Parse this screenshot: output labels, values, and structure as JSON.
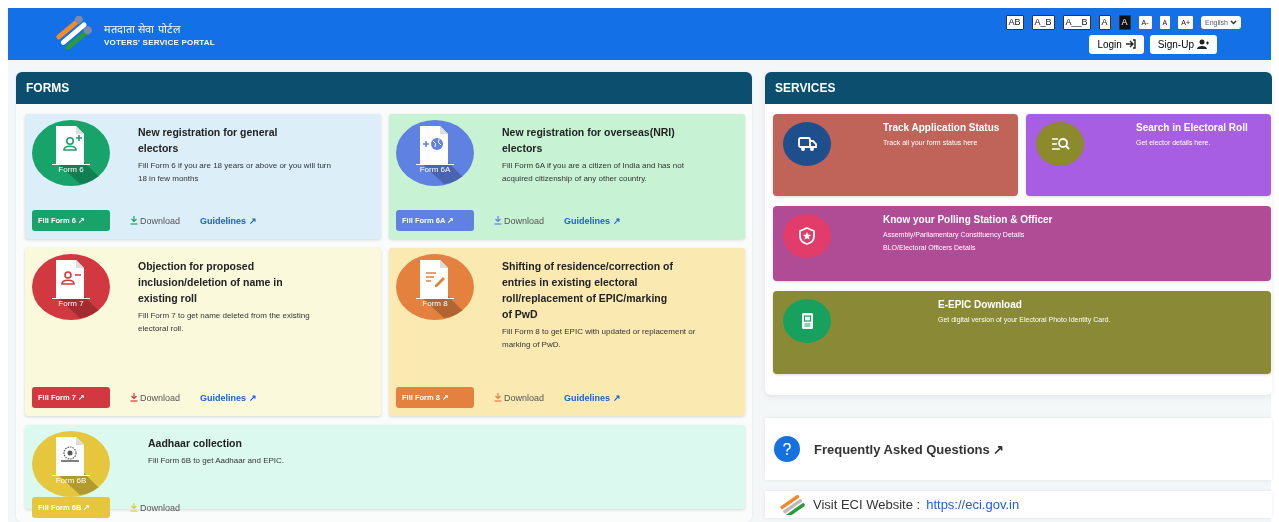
{
  "header": {
    "title_hindi": "मतदाता सेवा पोर्टल",
    "title": "VOTERS' SERVICE PORTAL",
    "spacing_buttons": [
      "AB",
      "A_B",
      "A__B"
    ],
    "contrast_buttons": [
      {
        "label": "A",
        "kind": "light"
      },
      {
        "label": "A",
        "kind": "dark"
      }
    ],
    "font_buttons": [
      "A-",
      "A",
      "A+"
    ],
    "language": "English",
    "login": "Login",
    "signup": "Sign-Up"
  },
  "forms": {
    "heading": "FORMS",
    "cards": [
      {
        "title": "New registration for general electors",
        "description": "Fill Form 6 if you are 18 years or above or you will turn 18 in few months",
        "icon_label": "Form 6",
        "button": "Fill Form 6 ↗",
        "download": "Download",
        "guidelines": "Guidelines ↗",
        "color": "#17a36a"
      },
      {
        "title": "New registration for overseas(NRI) electors",
        "description": "Fill Form 6A if you are a citizen of India and has not acquired citizenship of any other country.",
        "icon_label": "Form 6A",
        "button": "Fill Form 6A ↗",
        "download": "Download",
        "guidelines": "Guidelines ↗",
        "color": "#5f82e2"
      },
      {
        "title": "Objection for proposed inclusion/deletion of name in existing roll",
        "description": "Fill Form 7 to get name deleted from the existing electoral roll.",
        "icon_label": "Form 7",
        "button": "Fill Form 7 ↗",
        "download": "Download",
        "guidelines": "Guidelines ↗",
        "color": "#d2383f"
      },
      {
        "title": "Shifting of residence/correction of entries in existing electoral roll/replacement of EPIC/marking of PwD",
        "description": "Fill Form 8 to get EPIC with updated or replacement or marking of PwD.",
        "icon_label": "Form 8",
        "button": "Fill Form 8 ↗",
        "download": "Download",
        "guidelines": "Guidelines ↗",
        "color": "#e4813f"
      },
      {
        "title": "Aadhaar collection",
        "description": "Fill Form 6B to get Aadhaar and EPIC.",
        "icon_label": "Form 6B",
        "button": "Fill Form 6B ↗",
        "download": "Download",
        "color": "#e6c63c"
      }
    ]
  },
  "services": {
    "heading": "SERVICES",
    "cards": [
      {
        "title": "Track Application Status",
        "lines": [
          "Track all your form status here"
        ],
        "color": "#c0645a"
      },
      {
        "title": "Search in Electoral Roll",
        "lines": [
          "Get elector details here."
        ],
        "color": "#a75ee3"
      },
      {
        "title": "Know your Polling Station & Officer",
        "lines": [
          "Assembly/Parliamentary Constituency Details",
          "BLO/Electoral Officers Details"
        ],
        "color": "#b04b96"
      },
      {
        "title": "E-EPIC Download",
        "lines": [
          "Get digital version of your Electoral Photo Identity Card."
        ],
        "color": "#8a8a36"
      }
    ],
    "faq": "Frequently Asked Questions ↗",
    "eci_label": "Visit ECI Website :",
    "eci_link": "https://eci.gov.in"
  }
}
